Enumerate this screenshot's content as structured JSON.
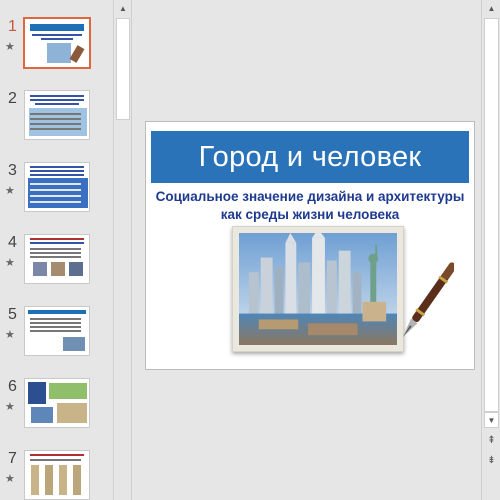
{
  "thumbnails": [
    {
      "number": "1",
      "has_animation_star": true,
      "selected": true
    },
    {
      "number": "2",
      "has_animation_star": false,
      "selected": false
    },
    {
      "number": "3",
      "has_animation_star": true,
      "selected": false
    },
    {
      "number": "4",
      "has_animation_star": true,
      "selected": false
    },
    {
      "number": "5",
      "has_animation_star": true,
      "selected": false
    },
    {
      "number": "6",
      "has_animation_star": true,
      "selected": false
    },
    {
      "number": "7",
      "has_animation_star": true,
      "selected": false
    }
  ],
  "star_glyph": "★",
  "slide": {
    "title": "Город и человек",
    "subtitle": "Социальное значение дизайна и архитектуры как среды жизни человека",
    "title_bar_color": "#2b73b9",
    "subtitle_color": "#1d3a8f"
  },
  "icons": {
    "scroll_up": "scroll-up-arrow-icon",
    "scroll_down": "scroll-down-arrow-icon",
    "prev_slide": "double-chevron-up-icon",
    "next_slide": "double-chevron-down-icon"
  },
  "accent_selected": "#e0663f"
}
